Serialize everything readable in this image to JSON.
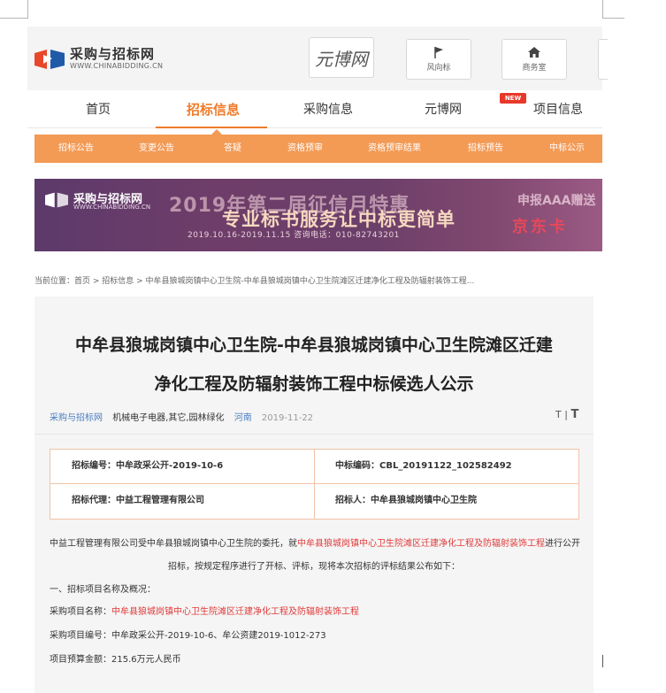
{
  "header": {
    "logo_name": "采购与招标网",
    "logo_domain": "WWW.CHINABIDDING.CN",
    "yuanbo_logo_text": "元博网",
    "buttons": [
      {
        "label": "风向标",
        "icon": "flag-icon"
      },
      {
        "label": "商务室",
        "icon": "home-icon"
      }
    ]
  },
  "nav": {
    "items": [
      "首页",
      "招标信息",
      "采购信息",
      "元博网",
      "项目信息"
    ],
    "active_index": 1,
    "hot_badge": "NEW"
  },
  "subnav": {
    "items": [
      "招标公告",
      "变更公告",
      "答疑",
      "资格预审",
      "资格预审结果",
      "招标预告",
      "中标公示"
    ]
  },
  "banner": {
    "logo_name": "采购与招标网",
    "logo_domain": "WWW.CHINABIDDING.CN",
    "headline": "2019年第二届征信月特惠",
    "subline": "专业标书服务让中标更简单",
    "dates": "2019.10.16-2019.11.15  咨询电话：010-82743201",
    "right_top": "申报AAA赠送",
    "right_bottom": "京东卡"
  },
  "breadcrumb": "当前位置：首页 > 招标信息 > 中牟县狼城岗镇中心卫生院-中牟县狼城岗镇中心卫生院滩区迁建净化工程及防辐射装饰工程...",
  "article": {
    "title_line1": "中牟县狼城岗镇中心卫生院-中牟县狼城岗镇中心卫生院滩区迁建",
    "title_line2": "净化工程及防辐射装饰工程中标候选人公示",
    "source": "采购与招标网",
    "categories": "机械电子电器,其它,园林绿化",
    "region": "河南",
    "date": "2019-11-22",
    "font_toggle_small": "T",
    "font_toggle_large": "T",
    "info_table": {
      "bid_no": "招标编号：中牟政采公开-2019-10-6",
      "award_code": "中标编码：CBL_20191122_102582492",
      "agent": "招标代理：中益工程管理有限公司",
      "tenderer": "招标人：中牟县狼城岗镇中心卫生院"
    },
    "intro_pre": "中益工程管理有限公司受中牟县狼城岗镇中心卫生院的委托，就",
    "intro_highlight": "中牟县狼城岗镇中心卫生院滩区迁建净化工程及防辐射装饰工程",
    "intro_post": "进行公开",
    "intro_line2": "招标，按规定程序进行了开标、评标，现将本次招标的评标结果公布如下：",
    "section1": "一、招标项目名称及概况：",
    "project_name_label": "采购项目名称：",
    "project_name_value": "中牟县狼城岗镇中心卫生院滩区迁建净化工程及防辐射装饰工程",
    "project_code": "采购项目编号：中牟政采公开-2019-10-6、牟公资建2019-1012-273",
    "project_budget": "项目预算金额：215.6万元人民币"
  }
}
